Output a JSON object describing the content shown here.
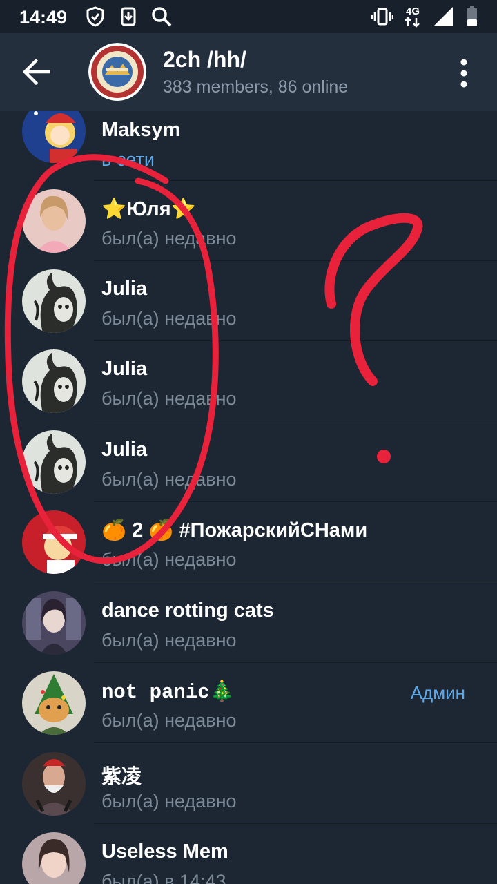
{
  "status_bar": {
    "time": "14:49",
    "network": "4G"
  },
  "header": {
    "title": "2ch /hh/",
    "subtitle": "383 members, 86 online"
  },
  "members": [
    {
      "name": "Maksym",
      "status": "в сети",
      "status_type": "online",
      "role": ""
    },
    {
      "name": "⭐Юля⭐",
      "status": "был(а) недавно",
      "status_type": "recent",
      "role": ""
    },
    {
      "name": "Julia",
      "status": "был(а) недавно",
      "status_type": "recent",
      "role": ""
    },
    {
      "name": "Julia",
      "status": "был(а) недавно",
      "status_type": "recent",
      "role": ""
    },
    {
      "name": "Julia",
      "status": "был(а) недавно",
      "status_type": "recent",
      "role": ""
    },
    {
      "name": "🍊 2 🍊 #ПожарскийСНами",
      "status": "был(а) недавно",
      "status_type": "recent",
      "role": ""
    },
    {
      "name": "dance rotting cats",
      "status": "был(а) недавно",
      "status_type": "recent",
      "role": ""
    },
    {
      "name": "not panic🎄",
      "status": "был(а) недавно",
      "status_type": "recent",
      "role": "Админ"
    },
    {
      "name": "紫凌",
      "status": "был(а) недавно",
      "status_type": "recent",
      "role": ""
    },
    {
      "name": "Useless Mem",
      "status": "был(а) в 14:43",
      "status_type": "recent",
      "role": ""
    }
  ],
  "colors": {
    "background": "#1d2733",
    "header": "#242f3d",
    "accent": "#5fa8e8",
    "annotation": "#e8223a"
  }
}
